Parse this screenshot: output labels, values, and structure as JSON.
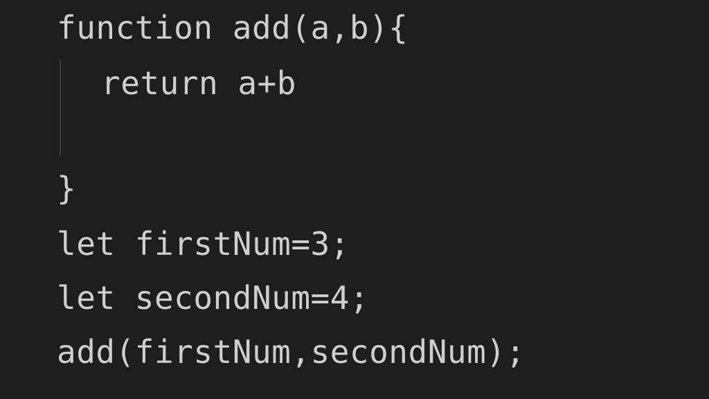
{
  "editor": {
    "lines": [
      "function add(a,b){",
      "return a+b",
      "",
      "}",
      "let firstNum=3;",
      "let secondNum=4;",
      "add(firstNum,secondNum);"
    ]
  }
}
